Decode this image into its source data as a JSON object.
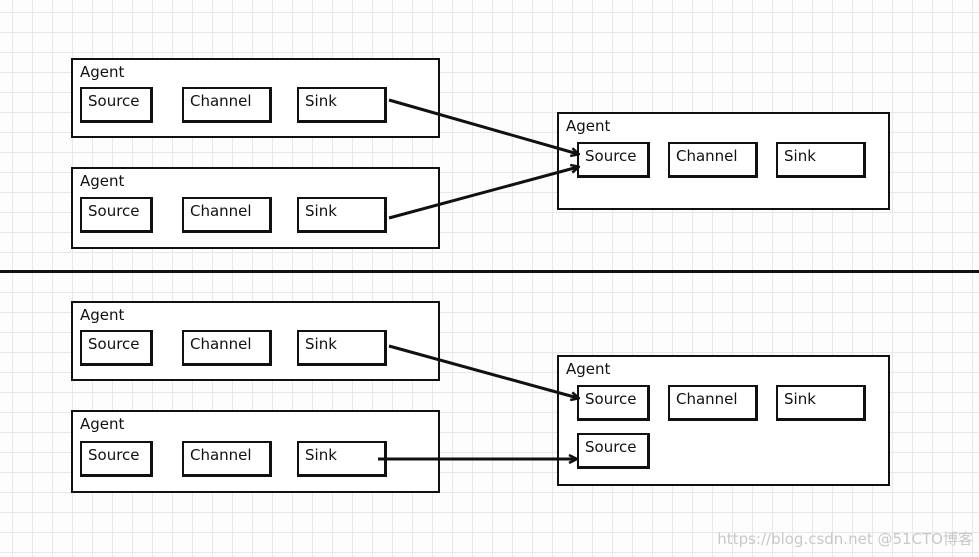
{
  "labels": {
    "agent": "Agent",
    "source": "Source",
    "channel": "Channel",
    "sink": "Sink"
  },
  "watermark": "https://blog.csdn.net @51CTO博客",
  "colors": {
    "stroke": "#111111",
    "grid": "#e8e8e8",
    "background": "#fdfdfd"
  },
  "sections": [
    {
      "name": "multiple agents to one source",
      "arrows": [
        "agent1.sink -> collector.source",
        "agent2.sink -> collector.source"
      ]
    },
    {
      "name": "multiple agents to multiple sources",
      "arrows": [
        "agent3.sink -> collector.source1",
        "agent4.sink -> collector.source2"
      ]
    }
  ]
}
